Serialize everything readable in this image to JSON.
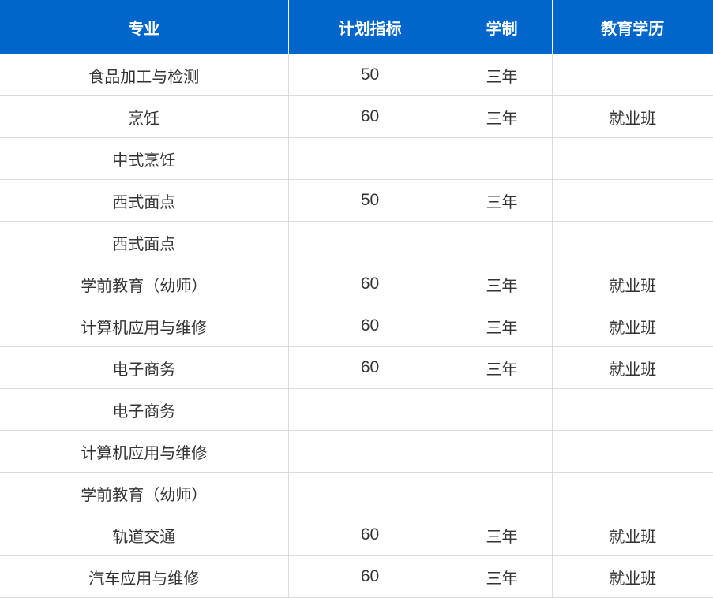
{
  "table": {
    "headers": [
      "专业",
      "计划指标",
      "学制",
      "教育学历"
    ],
    "rows": [
      [
        "食品加工与检测",
        "50",
        "三年",
        ""
      ],
      [
        "烹饪",
        "60",
        "三年",
        "就业班"
      ],
      [
        "中式烹饪",
        "",
        "",
        ""
      ],
      [
        "西式面点",
        "50",
        "三年",
        ""
      ],
      [
        "西式面点",
        "",
        "",
        ""
      ],
      [
        "学前教育（幼师）",
        "60",
        "三年",
        "就业班"
      ],
      [
        "计算机应用与维修",
        "60",
        "三年",
        "就业班"
      ],
      [
        "电子商务",
        "60",
        "三年",
        "就业班"
      ],
      [
        "电子商务",
        "",
        "",
        ""
      ],
      [
        "计算机应用与维修",
        "",
        "",
        ""
      ],
      [
        "学前教育（幼师）",
        "",
        "",
        ""
      ],
      [
        "轨道交通",
        "60",
        "三年",
        "就业班"
      ],
      [
        "汽车应用与维修",
        "60",
        "三年",
        "就业班"
      ]
    ]
  },
  "colors": {
    "header_bg": "#0066cc",
    "header_text": "#ffffff",
    "body_text": "#333333",
    "grid": "#dcdcdc"
  }
}
